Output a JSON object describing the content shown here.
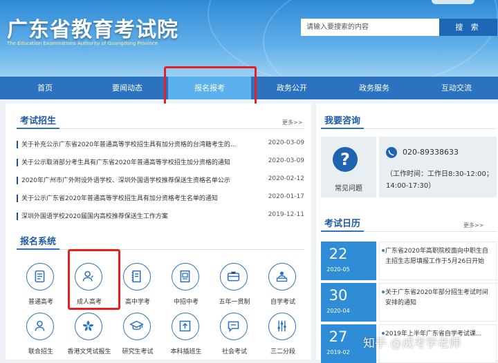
{
  "header": {
    "title_cn": "广东省教育考试院",
    "title_en": "The Education Examinations Authority of Guangdong Province",
    "top_button": "",
    "search_placeholder": "请输入要搜索的内容",
    "search_button": "搜 索"
  },
  "nav": [
    {
      "label": "首页"
    },
    {
      "label": "要闻动态"
    },
    {
      "label": "报名报考"
    },
    {
      "label": "政务公开"
    },
    {
      "label": "政务服务"
    },
    {
      "label": "互动交流"
    }
  ],
  "exam_recruit": {
    "title": "考试招生",
    "more": "更多>>",
    "items": [
      {
        "title": "关于补充公示广东省2020年普通高等学校招生具有加分资格的台湾籍考生的...",
        "date": "2020-03-09"
      },
      {
        "title": "关于公示取消部分考生具有广东省2020年普通高等学校招生加分资格的通知",
        "date": "2020-03-09"
      },
      {
        "title": "2020年广州市广外附设外语学校、深圳外国语学校推荐保送生资格名单公示",
        "date": "2020-02-12"
      },
      {
        "title": "关于公示广东省2020年普通高等学校招生具有加分资格考生名单的通知",
        "date": "2020-01-17"
      },
      {
        "title": "深圳外国语学校2020届国内高校推荐保送生工作方案",
        "date": "2019-12-11"
      }
    ]
  },
  "reg_system": {
    "title": "报名系统",
    "items": [
      {
        "label": "普通高考",
        "icon": "document-icon"
      },
      {
        "label": "成人高考",
        "icon": "adult-user-icon"
      },
      {
        "label": "高中学考",
        "icon": "notebook-icon"
      },
      {
        "label": "中招中考",
        "icon": "form-icon"
      },
      {
        "label": "五年一贯制",
        "icon": "briefcase-icon"
      },
      {
        "label": "自学考试",
        "icon": "laptop-user-icon"
      },
      {
        "label": "联合招生",
        "icon": "people-icon"
      },
      {
        "label": "香港文凭试报生",
        "icon": "bauhinia-icon"
      },
      {
        "label": "研究生考试",
        "icon": "graduation-cap-icon"
      },
      {
        "label": "本科插班生",
        "icon": "upload-icon"
      },
      {
        "label": "社会考试",
        "icon": "speech-bubble-icon"
      },
      {
        "label": "三二分段",
        "icon": "sliders-icon"
      }
    ]
  },
  "consult": {
    "title": "我要咨询",
    "faq_label": "常见问题",
    "phone": "020-89338633",
    "hours": "（工作时间：工作日8:30-12:00；14:00-17:30）"
  },
  "calendar": {
    "title": "考试日历",
    "more": "更多>>",
    "events": [
      {
        "day": "22",
        "ym": "2020-05",
        "text": "广东省2020年高职院校面向中职生自主招生志愿填报工作于5月26日开始"
      },
      {
        "day": "30",
        "ym": "2020-04",
        "text": "关于广东省2020年部分招生考试时间安排的通知"
      },
      {
        "day": "27",
        "ym": "2019-02",
        "text": "2019年上半年广东省自学考试课..."
      }
    ]
  },
  "watermark": "知乎 @成考学老师",
  "colors": {
    "nav_bg": "#2b72c0",
    "nav_active": "#5bb1ee",
    "accent": "#1e64b0",
    "highlight_box": "#e8201d"
  }
}
